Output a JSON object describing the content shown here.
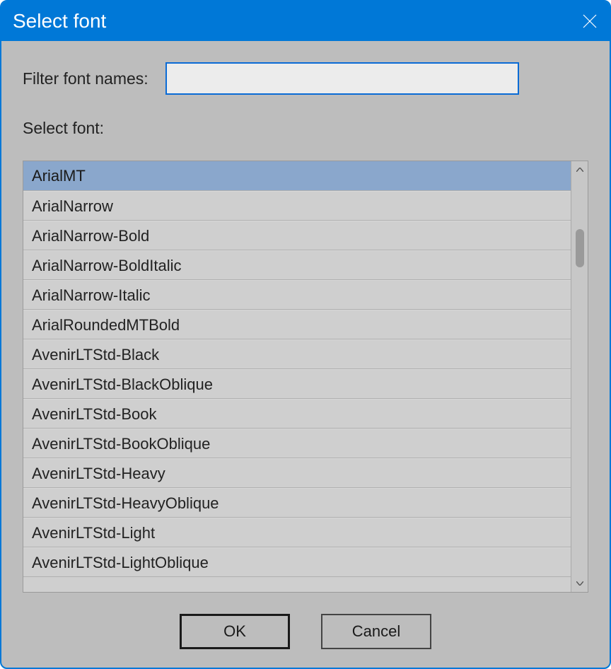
{
  "window": {
    "title": "Select font"
  },
  "filter": {
    "label": "Filter font names:",
    "value": ""
  },
  "select": {
    "label": "Select font:"
  },
  "fonts": {
    "selectedIndex": 0,
    "items": [
      "ArialMT",
      "ArialNarrow",
      "ArialNarrow-Bold",
      "ArialNarrow-BoldItalic",
      "ArialNarrow-Italic",
      "ArialRoundedMTBold",
      "AvenirLTStd-Black",
      "AvenirLTStd-BlackOblique",
      "AvenirLTStd-Book",
      "AvenirLTStd-BookOblique",
      "AvenirLTStd-Heavy",
      "AvenirLTStd-HeavyOblique",
      "AvenirLTStd-Light",
      "AvenirLTStd-LightOblique"
    ]
  },
  "buttons": {
    "ok": "OK",
    "cancel": "Cancel"
  }
}
